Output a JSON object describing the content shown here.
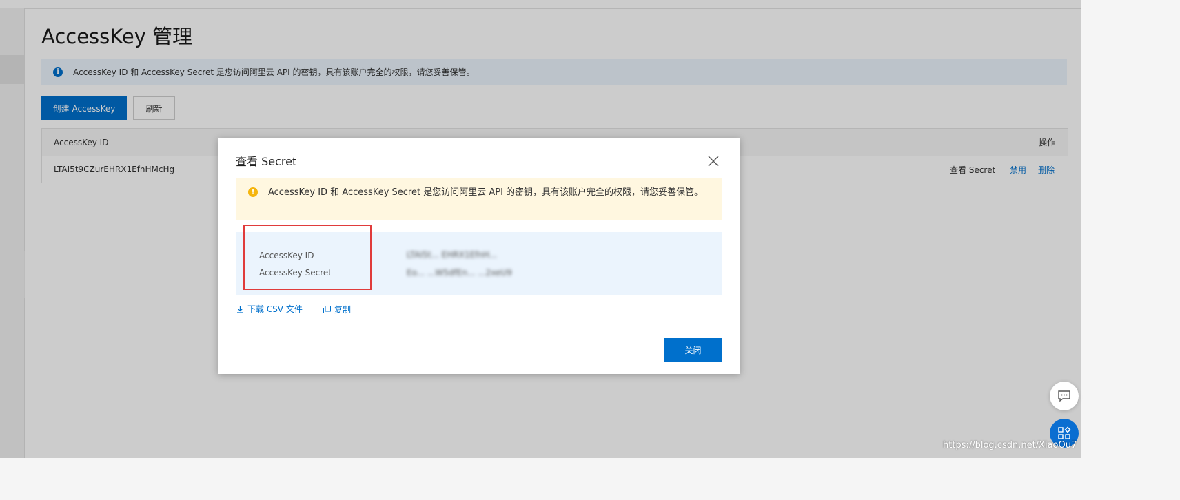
{
  "page": {
    "title": "AccessKey 管理",
    "info_banner": "AccessKey ID 和 AccessKey Secret 是您访问阿里云 API 的密钥，具有该账户完全的权限，请您妥善保管。"
  },
  "toolbar": {
    "create_label": "创建 AccessKey",
    "refresh_label": "刷新"
  },
  "table": {
    "columns": [
      "AccessKey ID",
      "操作"
    ],
    "rows": [
      {
        "access_key_id": "LTAI5t9CZurEHRX1EfnHMcHg",
        "actions": [
          "查看 Secret",
          "禁用",
          "删除"
        ]
      }
    ]
  },
  "modal": {
    "title": "查看 Secret",
    "warning": "AccessKey ID 和 AccessKey Secret 是您访问阿里云 API 的密钥，具有该账户完全的权限，请您妥善保管。",
    "fields": [
      {
        "label": "AccessKey ID",
        "value": "LTAI5t... EHRX1EfnH..."
      },
      {
        "label": "AccessKey Secret",
        "value": "Eo... ...W5dfEn... ...2xeU9"
      }
    ],
    "download_label": "下载 CSV 文件",
    "copy_label": "复制",
    "close_label": "关闭"
  },
  "watermark": "https://blog.csdn.net/XiaoOu7",
  "colors": {
    "primary": "#0070cc",
    "info_bg": "#ebf4fd",
    "warning_bg": "#fff7e0",
    "warning_icon": "#f5b50e",
    "highlight": "#e03b3b"
  },
  "icons": [
    "info-icon",
    "warning-icon",
    "close-icon",
    "download-icon",
    "copy-icon",
    "chevron-left-icon",
    "chat-icon",
    "apps-icon"
  ]
}
